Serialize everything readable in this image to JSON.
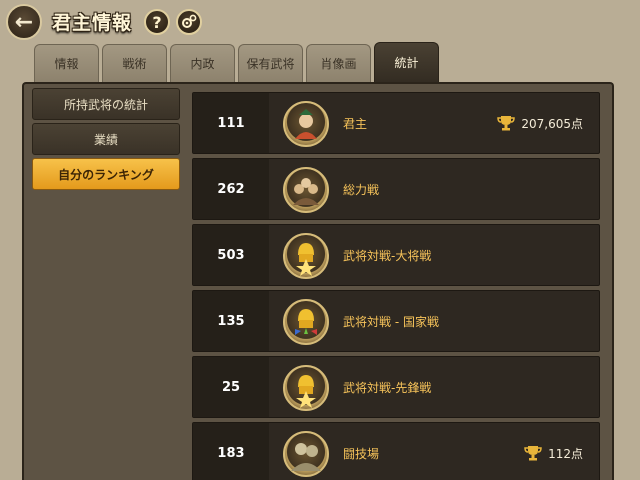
{
  "header": {
    "back_icon": "arrow-left-icon",
    "title": "君主情報",
    "help_icon": "question-icon",
    "help_glyph": "?",
    "settings_icon": "gears-icon"
  },
  "tabs": [
    {
      "label": "情報"
    },
    {
      "label": "戦術"
    },
    {
      "label": "内政"
    },
    {
      "label": "保有武将"
    },
    {
      "label": "肖像画"
    },
    {
      "label": "統計",
      "active": true
    }
  ],
  "sidebar": {
    "items": [
      {
        "label": "所持武将の統計"
      },
      {
        "label": "業績"
      },
      {
        "label": "自分のランキング",
        "active": true
      }
    ]
  },
  "rankings": [
    {
      "rank": "111",
      "mode": "君主",
      "score": "207,605点",
      "badge": "lord-portrait-icon"
    },
    {
      "rank": "262",
      "mode": "総力戦",
      "score": "",
      "badge": "total-war-icon"
    },
    {
      "rank": "503",
      "mode": "武将対戦-大将戦",
      "score": "",
      "badge": "general-helmet-star-icon"
    },
    {
      "rank": "135",
      "mode": "武将対戦 - 国家戦",
      "score": "",
      "badge": "general-helmet-flags-icon"
    },
    {
      "rank": "25",
      "mode": "武将対戦-先鋒戦",
      "score": "",
      "badge": "general-helmet-star-icon"
    },
    {
      "rank": "183",
      "mode": "闘技場",
      "score": "112点",
      "badge": "arena-warriors-icon"
    }
  ],
  "colors": {
    "accent": "#f6c35a",
    "active_tab": "#3a3227",
    "active_sidebar": "#f2b438"
  }
}
